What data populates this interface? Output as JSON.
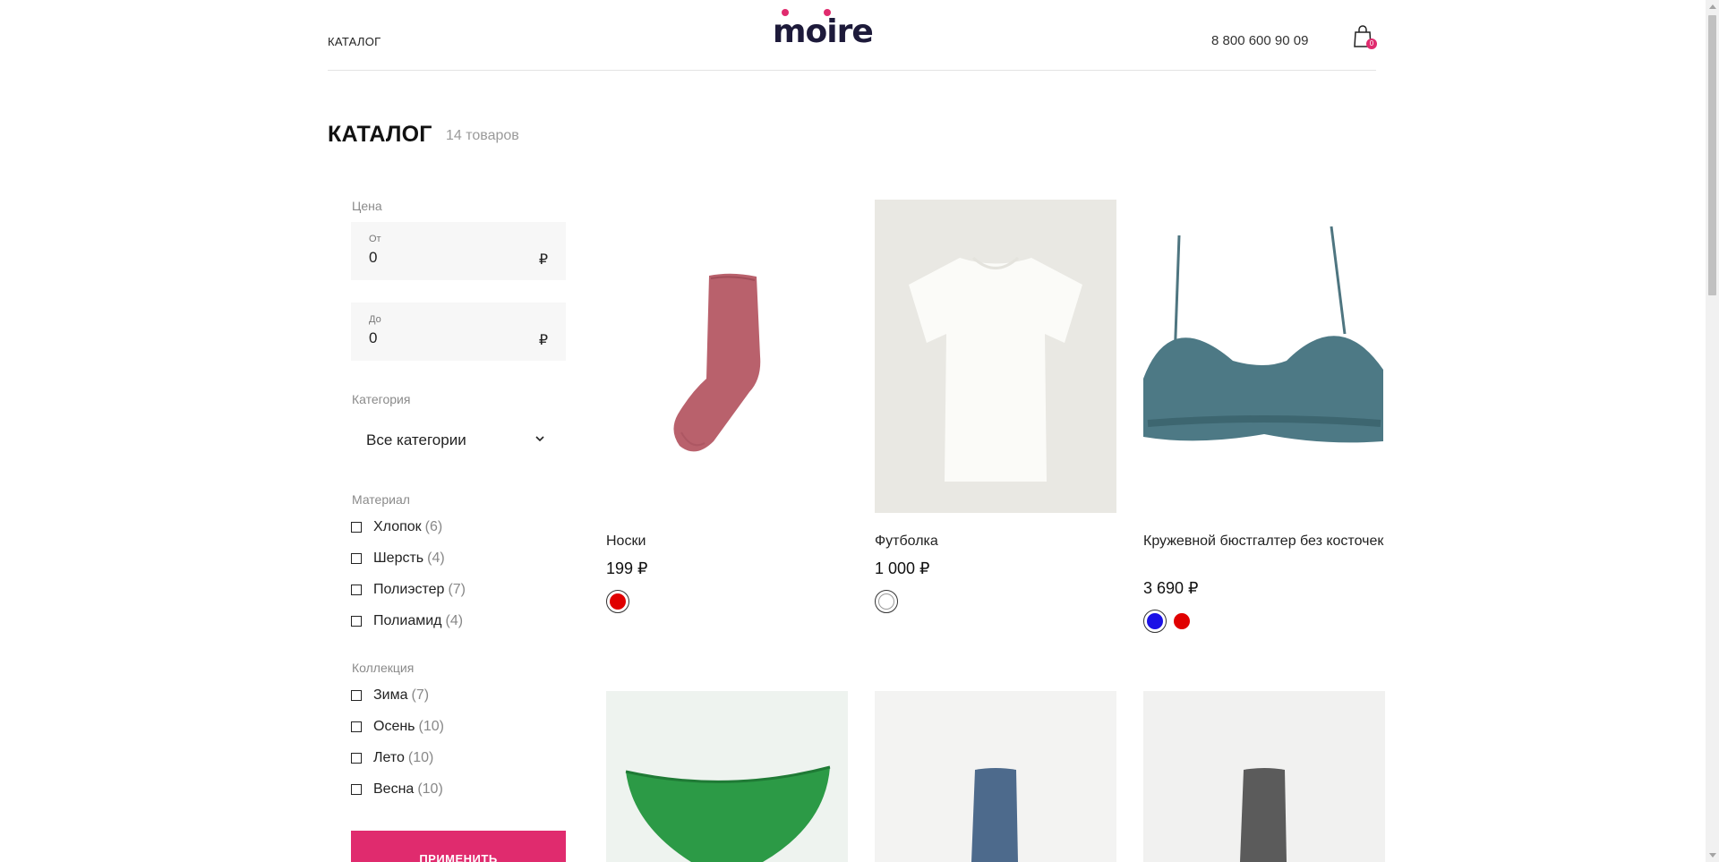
{
  "header": {
    "nav_catalog": "КАТАЛОГ",
    "logo": "moire",
    "phone": "8 800 600 90 09",
    "cart_count": "0"
  },
  "page": {
    "title": "КАТАЛОГ",
    "count": "14 товаров"
  },
  "filter": {
    "price_label": "Цена",
    "from_caption": "От",
    "from_value": "0",
    "to_caption": "До",
    "to_value": "0",
    "currency": "₽",
    "category_label": "Категория",
    "category_value": "Все категории",
    "material_label": "Материал",
    "materials": [
      {
        "name": "Хлопок",
        "count": "(6)"
      },
      {
        "name": "Шерсть",
        "count": "(4)"
      },
      {
        "name": "Полиэстер",
        "count": "(7)"
      },
      {
        "name": "Полиамид",
        "count": "(4)"
      }
    ],
    "collection_label": "Коллекция",
    "collections": [
      {
        "name": "Зима",
        "count": "(7)"
      },
      {
        "name": "Осень",
        "count": "(10)"
      },
      {
        "name": "Лето",
        "count": "(10)"
      },
      {
        "name": "Весна",
        "count": "(10)"
      }
    ],
    "apply_label": "Применить"
  },
  "products": [
    {
      "name": "Носки",
      "price": "199 ₽",
      "colors": [
        "#e00000"
      ],
      "image": "sock-red"
    },
    {
      "name": "Футболка",
      "price": "1 000 ₽",
      "colors": [
        "#ffffff"
      ],
      "image": "tshirt-white"
    },
    {
      "name": "Кружевной бюстгалтер без косточек",
      "price": "3 690 ₽",
      "colors": [
        "#1a10e6",
        "#e00000"
      ],
      "image": "bra-teal"
    },
    {
      "name": "",
      "price": "",
      "colors": [],
      "image": "briefs-green"
    },
    {
      "name": "",
      "price": "",
      "colors": [],
      "image": "sock-blue"
    },
    {
      "name": "",
      "price": "",
      "colors": [],
      "image": "sock-grey"
    }
  ]
}
